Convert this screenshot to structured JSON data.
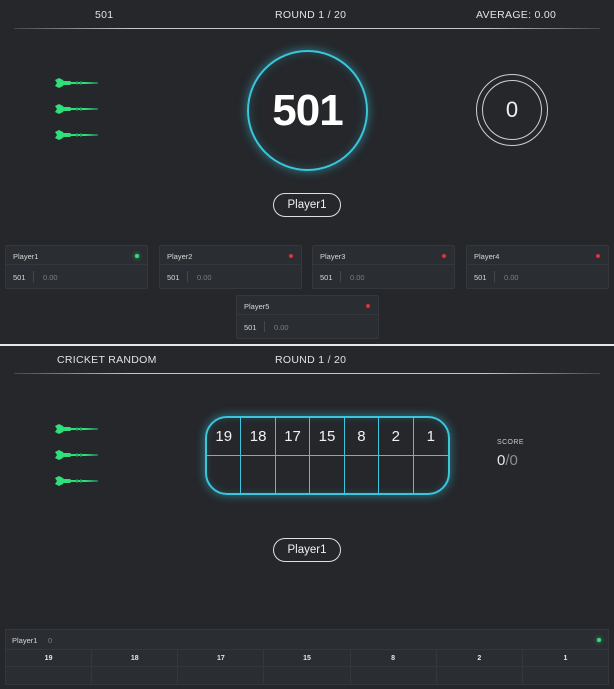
{
  "x01_panel": {
    "game_name": "501",
    "round_label": "ROUND 1 / 20",
    "average_label": "AVERAGE: 0.00",
    "main_score": "501",
    "turn_score": "0",
    "active_player": "Player1",
    "darts_remaining": 3,
    "players": [
      {
        "name": "Player1",
        "score": "501",
        "average": "0.00",
        "status": "active"
      },
      {
        "name": "Player2",
        "score": "501",
        "average": "0.00",
        "status": "inactive"
      },
      {
        "name": "Player3",
        "score": "501",
        "average": "0.00",
        "status": "inactive"
      },
      {
        "name": "Player4",
        "score": "501",
        "average": "0.00",
        "status": "inactive"
      },
      {
        "name": "Player5",
        "score": "501",
        "average": "0.00",
        "status": "inactive"
      }
    ]
  },
  "cricket_panel": {
    "game_name": "CRICKET RANDOM",
    "round_label": "ROUND 1 / 20",
    "numbers": [
      "19",
      "18",
      "17",
      "15",
      "8",
      "2",
      "1"
    ],
    "score_label": "SCORE",
    "score_current": "0",
    "score_separator": "/",
    "score_max": "0",
    "active_player": "Player1",
    "darts_remaining": 3,
    "table": {
      "player_name": "Player1",
      "player_score": "0",
      "status": "active",
      "columns": [
        "19",
        "18",
        "17",
        "15",
        "8",
        "2",
        "1"
      ]
    }
  },
  "colors": {
    "accent_ring": "#3ac6dc",
    "dart_green": "#2fe07a",
    "status_active": "#2fe07a",
    "status_inactive": "#e0313a",
    "background": "#25272b"
  },
  "icons": {
    "dart": "dart-icon",
    "status_dot": "status-dot-icon"
  }
}
